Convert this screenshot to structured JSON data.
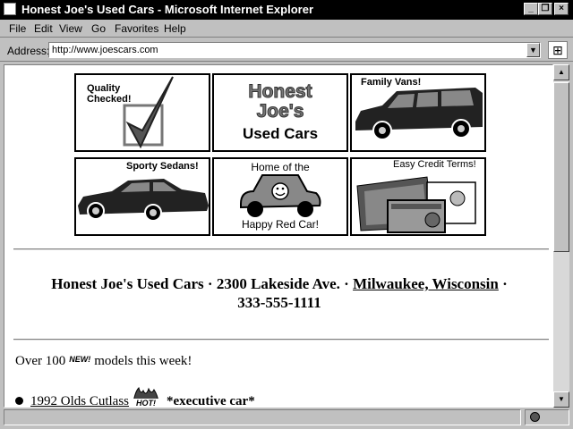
{
  "window": {
    "title": "Honest Joe's Used Cars - Microsoft Internet Explorer",
    "minimize": "_",
    "restore": "❐",
    "close": "×"
  },
  "menu": [
    "File",
    "Edit",
    "View",
    "Go",
    "Favorites",
    "Help"
  ],
  "address": {
    "label": "Address:",
    "url": "http://www.joescars.com"
  },
  "tiles": {
    "quality": "Quality Checked!",
    "logo_line1": "Honest",
    "logo_line2": "Joe's",
    "logo_line3": "Used Cars",
    "vans": "Family Vans!",
    "sedans": "Sporty Sedans!",
    "home_of": "Home of the",
    "happy_car": "Happy Red Car!",
    "credit": "Easy Credit Terms!"
  },
  "headline": {
    "part1": "Honest Joe's Used Cars · 2300 Lakeside Ave. · ",
    "city": "Milwaukee, Wisconsin",
    "part2": " ·",
    "phone": "333-555-1111"
  },
  "promo": {
    "before": "Over 100",
    "new_badge": "NEW!",
    "after": "models this week!"
  },
  "listing": {
    "car_link": "1992 Olds Cutlass",
    "hot_badge": "HOT!",
    "note": "*executive car*"
  },
  "colors": {
    "titlebar": "#000000",
    "chrome": "#c0c0c0",
    "page": "#ffffff"
  }
}
